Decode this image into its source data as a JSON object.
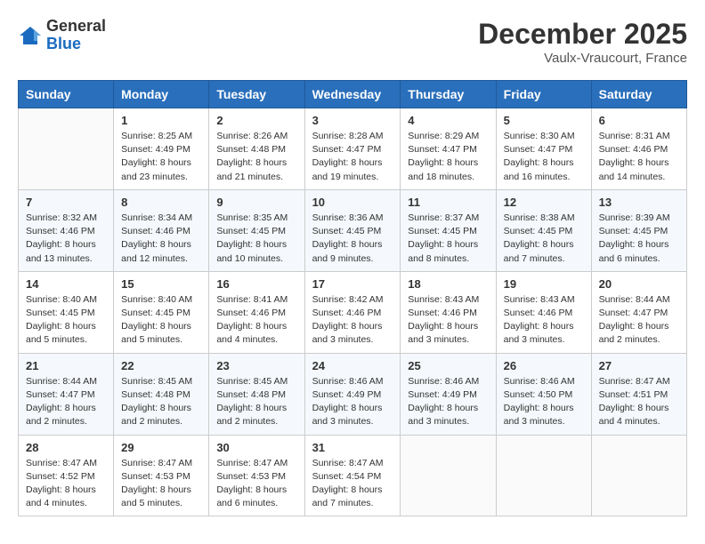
{
  "header": {
    "logo_general": "General",
    "logo_blue": "Blue",
    "month_title": "December 2025",
    "location": "Vaulx-Vraucourt, France"
  },
  "days_of_week": [
    "Sunday",
    "Monday",
    "Tuesday",
    "Wednesday",
    "Thursday",
    "Friday",
    "Saturday"
  ],
  "weeks": [
    [
      {
        "day": "",
        "info": ""
      },
      {
        "day": "1",
        "info": "Sunrise: 8:25 AM\nSunset: 4:49 PM\nDaylight: 8 hours\nand 23 minutes."
      },
      {
        "day": "2",
        "info": "Sunrise: 8:26 AM\nSunset: 4:48 PM\nDaylight: 8 hours\nand 21 minutes."
      },
      {
        "day": "3",
        "info": "Sunrise: 8:28 AM\nSunset: 4:47 PM\nDaylight: 8 hours\nand 19 minutes."
      },
      {
        "day": "4",
        "info": "Sunrise: 8:29 AM\nSunset: 4:47 PM\nDaylight: 8 hours\nand 18 minutes."
      },
      {
        "day": "5",
        "info": "Sunrise: 8:30 AM\nSunset: 4:47 PM\nDaylight: 8 hours\nand 16 minutes."
      },
      {
        "day": "6",
        "info": "Sunrise: 8:31 AM\nSunset: 4:46 PM\nDaylight: 8 hours\nand 14 minutes."
      }
    ],
    [
      {
        "day": "7",
        "info": "Sunrise: 8:32 AM\nSunset: 4:46 PM\nDaylight: 8 hours\nand 13 minutes."
      },
      {
        "day": "8",
        "info": "Sunrise: 8:34 AM\nSunset: 4:46 PM\nDaylight: 8 hours\nand 12 minutes."
      },
      {
        "day": "9",
        "info": "Sunrise: 8:35 AM\nSunset: 4:45 PM\nDaylight: 8 hours\nand 10 minutes."
      },
      {
        "day": "10",
        "info": "Sunrise: 8:36 AM\nSunset: 4:45 PM\nDaylight: 8 hours\nand 9 minutes."
      },
      {
        "day": "11",
        "info": "Sunrise: 8:37 AM\nSunset: 4:45 PM\nDaylight: 8 hours\nand 8 minutes."
      },
      {
        "day": "12",
        "info": "Sunrise: 8:38 AM\nSunset: 4:45 PM\nDaylight: 8 hours\nand 7 minutes."
      },
      {
        "day": "13",
        "info": "Sunrise: 8:39 AM\nSunset: 4:45 PM\nDaylight: 8 hours\nand 6 minutes."
      }
    ],
    [
      {
        "day": "14",
        "info": "Sunrise: 8:40 AM\nSunset: 4:45 PM\nDaylight: 8 hours\nand 5 minutes."
      },
      {
        "day": "15",
        "info": "Sunrise: 8:40 AM\nSunset: 4:45 PM\nDaylight: 8 hours\nand 5 minutes."
      },
      {
        "day": "16",
        "info": "Sunrise: 8:41 AM\nSunset: 4:46 PM\nDaylight: 8 hours\nand 4 minutes."
      },
      {
        "day": "17",
        "info": "Sunrise: 8:42 AM\nSunset: 4:46 PM\nDaylight: 8 hours\nand 3 minutes."
      },
      {
        "day": "18",
        "info": "Sunrise: 8:43 AM\nSunset: 4:46 PM\nDaylight: 8 hours\nand 3 minutes."
      },
      {
        "day": "19",
        "info": "Sunrise: 8:43 AM\nSunset: 4:46 PM\nDaylight: 8 hours\nand 3 minutes."
      },
      {
        "day": "20",
        "info": "Sunrise: 8:44 AM\nSunset: 4:47 PM\nDaylight: 8 hours\nand 2 minutes."
      }
    ],
    [
      {
        "day": "21",
        "info": "Sunrise: 8:44 AM\nSunset: 4:47 PM\nDaylight: 8 hours\nand 2 minutes."
      },
      {
        "day": "22",
        "info": "Sunrise: 8:45 AM\nSunset: 4:48 PM\nDaylight: 8 hours\nand 2 minutes."
      },
      {
        "day": "23",
        "info": "Sunrise: 8:45 AM\nSunset: 4:48 PM\nDaylight: 8 hours\nand 2 minutes."
      },
      {
        "day": "24",
        "info": "Sunrise: 8:46 AM\nSunset: 4:49 PM\nDaylight: 8 hours\nand 3 minutes."
      },
      {
        "day": "25",
        "info": "Sunrise: 8:46 AM\nSunset: 4:49 PM\nDaylight: 8 hours\nand 3 minutes."
      },
      {
        "day": "26",
        "info": "Sunrise: 8:46 AM\nSunset: 4:50 PM\nDaylight: 8 hours\nand 3 minutes."
      },
      {
        "day": "27",
        "info": "Sunrise: 8:47 AM\nSunset: 4:51 PM\nDaylight: 8 hours\nand 4 minutes."
      }
    ],
    [
      {
        "day": "28",
        "info": "Sunrise: 8:47 AM\nSunset: 4:52 PM\nDaylight: 8 hours\nand 4 minutes."
      },
      {
        "day": "29",
        "info": "Sunrise: 8:47 AM\nSunset: 4:53 PM\nDaylight: 8 hours\nand 5 minutes."
      },
      {
        "day": "30",
        "info": "Sunrise: 8:47 AM\nSunset: 4:53 PM\nDaylight: 8 hours\nand 6 minutes."
      },
      {
        "day": "31",
        "info": "Sunrise: 8:47 AM\nSunset: 4:54 PM\nDaylight: 8 hours\nand 7 minutes."
      },
      {
        "day": "",
        "info": ""
      },
      {
        "day": "",
        "info": ""
      },
      {
        "day": "",
        "info": ""
      }
    ]
  ]
}
